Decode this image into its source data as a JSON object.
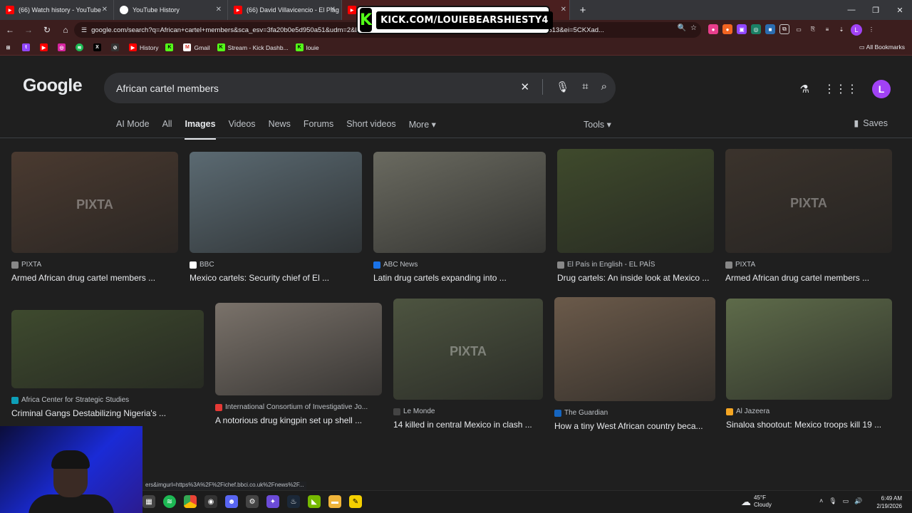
{
  "browser": {
    "tabs": [
      {
        "title": "(66) Watch history - YouTube",
        "favicon": "youtube-icon"
      },
      {
        "title": "YouTube History",
        "favicon": "google-icon"
      },
      {
        "title": "(66) David Villavicencio - El Plag",
        "favicon": "youtube-icon"
      }
    ],
    "url": "google.com/search?q=African+cartel+members&sca_esv=3fa20b0e5d950a51&udm=2&bi...=1725d2d...&ei=6n0...uACIShmqV3T1RSQ%3A1771512548813&ei=5CKXad...",
    "bookmarks": [
      "History",
      "Gmail",
      "Stream - Kick Dashb...",
      "louie"
    ],
    "all_bookmarks": "All Bookmarks",
    "profile_initial": "L"
  },
  "kick_overlay": {
    "text": "KICK.COM/LOUIEBEARSHIESTY4",
    "logo": "K"
  },
  "search": {
    "logo_text": "Google",
    "query": "African cartel members",
    "tabs": [
      "AI Mode",
      "All",
      "Images",
      "Videos",
      "News",
      "Forums",
      "Short videos",
      "More"
    ],
    "active_tab": "Images",
    "tools_label": "Tools",
    "saves_label": "Saves",
    "user_initial": "L"
  },
  "results": [
    {
      "source": "PIXTA",
      "caption": "Armed African drug cartel members ...",
      "color": "#4a3a30",
      "watermark": "PIXTA"
    },
    {
      "source": "BBC",
      "caption": "Mexico cartels: Security chief of El ...",
      "color": "#5b6a72",
      "watermark": ""
    },
    {
      "source": "ABC News",
      "caption": "Latin drug cartels expanding into ...",
      "color": "#6a6a60",
      "watermark": ""
    },
    {
      "source": "El País in English - EL PAÍS",
      "caption": "Drug cartels: An inside look at Mexico ...",
      "color": "#3f4a2c",
      "watermark": ""
    },
    {
      "source": "PIXTA",
      "caption": "Armed African drug cartel members ...",
      "color": "#3b332c",
      "watermark": "PIXTA"
    },
    {
      "source": "Africa Center for Strategic Studies",
      "caption": "Criminal Gangs Destabilizing Nigeria's ...",
      "color": "#3e4a2e",
      "watermark": ""
    },
    {
      "source": "International Consortium of Investigative Jo...",
      "caption": "A notorious drug kingpin set up shell ...",
      "color": "#7a726a",
      "watermark": ""
    },
    {
      "source": "Le Monde",
      "caption": "14 killed in central Mexico in clash ...",
      "color": "#4d5440",
      "watermark": "PIXTA"
    },
    {
      "source": "The Guardian",
      "caption": "How a tiny West African country beca...",
      "color": "#6b5a4a",
      "watermark": ""
    },
    {
      "source": "Al Jazeera",
      "caption": "Sinaloa shootout: Mexico troops kill 19 ...",
      "color": "#5e6b4a",
      "watermark": ""
    }
  ],
  "status_url": "ers&imgurl=https%3A%2F%2Fichef.bbci.co.uk%2Fnews%2F...",
  "taskbar": {
    "weather_temp": "45°F",
    "weather_desc": "Cloudy",
    "time": "6:49 AM",
    "date": "2/19/2026"
  }
}
